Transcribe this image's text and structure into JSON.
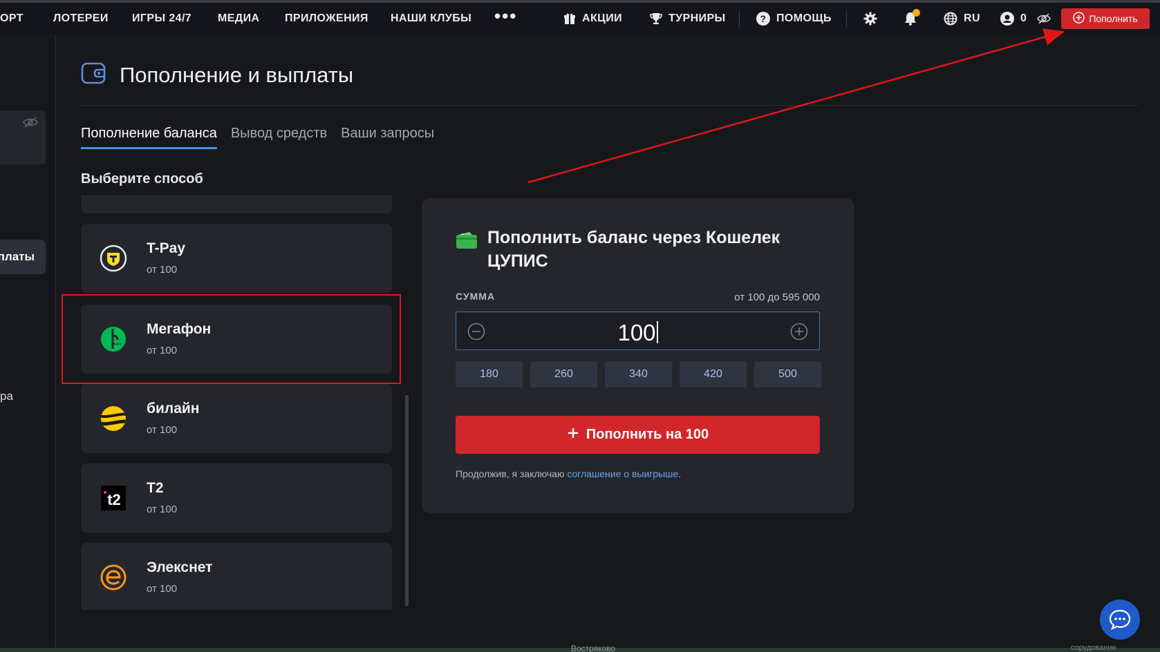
{
  "nav": {
    "items": [
      {
        "label": "ОРТ"
      },
      {
        "label": "ЛОТЕРЕИ"
      },
      {
        "label": "ИГРЫ 24/7"
      },
      {
        "label": "МЕДИА"
      },
      {
        "label": "ПРИЛОЖЕНИЯ"
      },
      {
        "label": "НАШИ КЛУБЫ"
      }
    ],
    "more_label": "•••",
    "promo_label": "АКЦИИ",
    "tournaments_label": "ТУРНИРЫ",
    "help_label": "ПОМОЩЬ",
    "language_label": "RU",
    "balance_label": "0",
    "topup_label": "Пополнить",
    "colors": {
      "accent_red": "#d2272a",
      "notification_dot": "#f5a623"
    }
  },
  "sidebar": {
    "active_item_label": "лплаты",
    "partial_text": "ра"
  },
  "page": {
    "title": "Пополнение и выплаты",
    "icon": "wallet-icon"
  },
  "tabs": [
    {
      "label": "Пополнение баланса",
      "active": true
    },
    {
      "label": "Вывод средств",
      "active": false
    },
    {
      "label": "Ваши запросы",
      "active": false
    }
  ],
  "methods": {
    "heading": "Выберите способ",
    "items": [
      {
        "name": "T-Pay",
        "min": "от 100",
        "icon": "tpay-logo-icon"
      },
      {
        "name": "Мегафон",
        "min": "от 100",
        "icon": "megafon-logo-icon",
        "highlighted": true
      },
      {
        "name": "билайн",
        "min": "от 100",
        "icon": "beeline-logo-icon"
      },
      {
        "name": "T2",
        "min": "от 100",
        "icon": "t2-logo-icon"
      },
      {
        "name": "Элекснет",
        "min": "от 100",
        "icon": "elecsnet-logo-icon"
      }
    ]
  },
  "form": {
    "title": "Пополнить баланс через Кошелек ЦУПИС",
    "sum_label": "СУММА",
    "range_label": "от 100 до 595 000",
    "amount_value": "100",
    "presets": [
      "180",
      "260",
      "340",
      "420",
      "500"
    ],
    "submit_label": "Пополнить на 100",
    "agreement_prefix": "Продолжив, я заключаю ",
    "agreement_link": "соглашение о выигрыше",
    "agreement_suffix": "."
  },
  "footer": {
    "map_text": "Востряково",
    "small_text": "сорудование"
  }
}
